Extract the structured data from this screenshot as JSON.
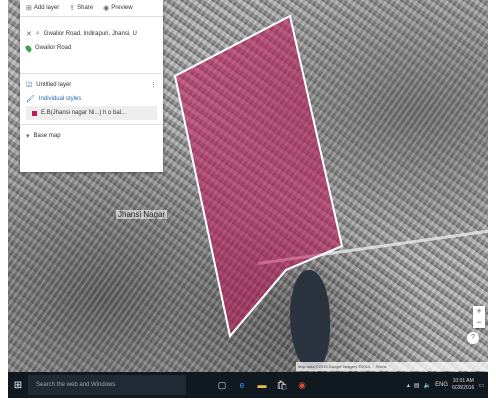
{
  "panel": {
    "toolbar": {
      "add_layer": "Add layer",
      "share": "Share",
      "preview": "Preview"
    },
    "search_value": "Gwalior Road, Indirapuri, Jhansi, U",
    "pin_label": "Gwalior Road",
    "layer_title": "Untitled layer",
    "individual_styles": "Individual styles",
    "feature_label": "E.B(Jhansi nagar Ni...) h o bal...",
    "base_map": "Base map"
  },
  "map": {
    "label_left": "Jhansi Nagar"
  },
  "attribution": "Map data ©2015 Google Imagery ©2015 ... Terms",
  "taskbar": {
    "search_placeholder": "Search the web and Windows",
    "time": "10:01 AM",
    "date": "6/28/2016",
    "lang": "ENG"
  },
  "colors": {
    "polygon_fill": "#c2185b",
    "polygon_stroke": "#ffffff"
  }
}
